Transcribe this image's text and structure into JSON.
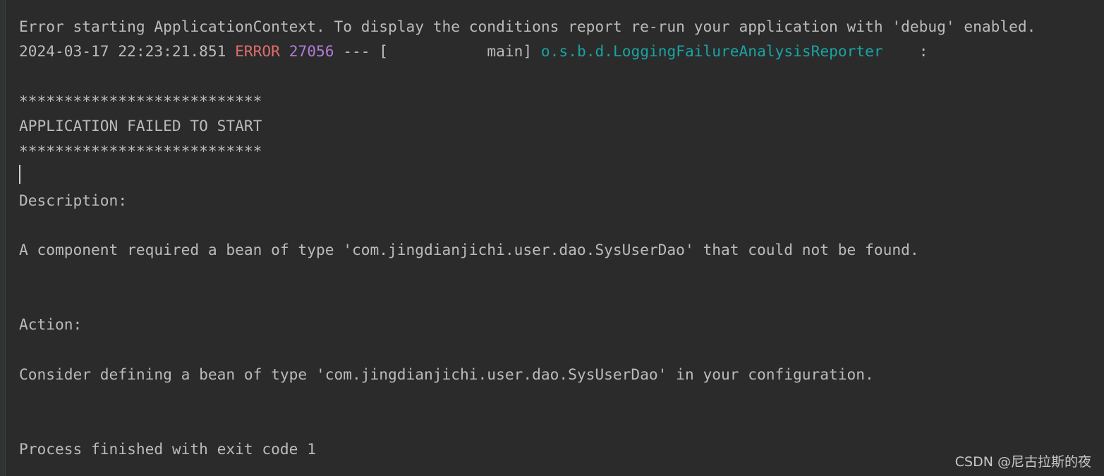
{
  "console": {
    "line1": "Error starting ApplicationContext. To display the conditions report re-run your application with 'debug' enabled.",
    "log": {
      "timestamp": "2024-03-17 22:23:21.851",
      "level": "ERROR",
      "pid": "27056",
      "separator": "---",
      "thread": "[           main]",
      "logger": "o.s.b.d.LoggingFailureAnalysisReporter",
      "colon": ":"
    },
    "stars_top": "***************************",
    "banner": "APPLICATION FAILED TO START",
    "stars_bottom": "***************************",
    "description_label": "Description:",
    "description": "A component required a bean of type 'com.jingdianjichi.user.dao.SysUserDao' that could not be found.",
    "action_label": "Action:",
    "action": "Consider defining a bean of type 'com.jingdianjichi.user.dao.SysUserDao' in your configuration.",
    "exit": "Process finished with exit code 1"
  },
  "watermark": "CSDN @尼古拉斯的夜",
  "colors": {
    "background": "#2b2b2b",
    "text": "#bbbbbb",
    "error": "#e06c6c",
    "pid": "#b07cd8",
    "logger": "#1aa3a3"
  }
}
